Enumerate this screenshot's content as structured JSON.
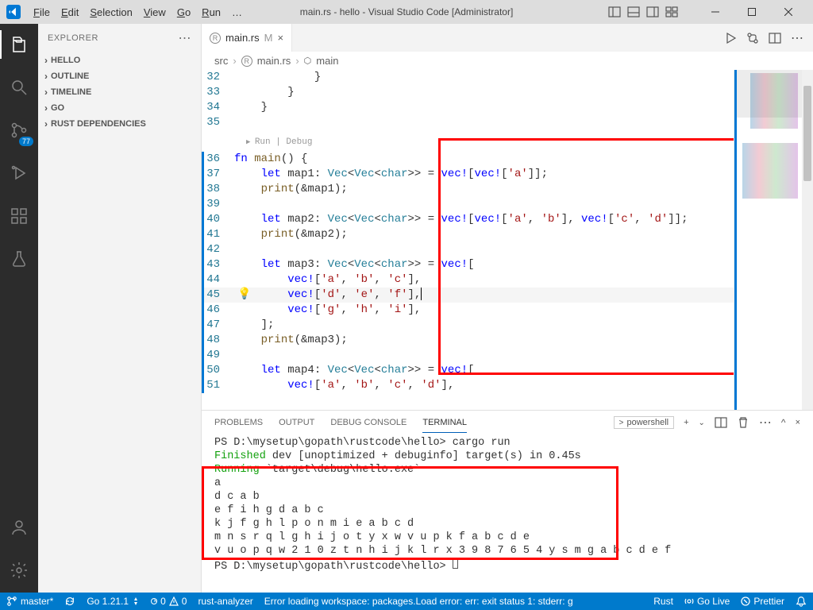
{
  "title": "main.rs - hello - Visual Studio Code [Administrator]",
  "menu": [
    "File",
    "Edit",
    "Selection",
    "View",
    "Go",
    "Run",
    "…"
  ],
  "explorer": {
    "title": "EXPLORER",
    "items": [
      "HELLO",
      "OUTLINE",
      "TIMELINE",
      "GO",
      "RUST DEPENDENCIES"
    ]
  },
  "activity_badge": "77",
  "tab": {
    "icon": "rust",
    "name": "main.rs",
    "modified": "M"
  },
  "breadcrumbs": [
    "src",
    "main.rs",
    "main"
  ],
  "codelens": "Run | Debug",
  "code_lines": [
    {
      "n": 32,
      "t": "            }"
    },
    {
      "n": 33,
      "t": "        }"
    },
    {
      "n": 34,
      "t": "    }"
    },
    {
      "n": 35,
      "t": ""
    },
    {
      "n": 36,
      "t": "fn main() {",
      "hl": false
    },
    {
      "n": 37,
      "t": "    let map1: Vec<Vec<char>> = vec![vec!['a']];"
    },
    {
      "n": 38,
      "t": "    print(&map1);"
    },
    {
      "n": 39,
      "t": ""
    },
    {
      "n": 40,
      "t": "    let map2: Vec<Vec<char>> = vec![vec!['a', 'b'], vec!['c', 'd']];"
    },
    {
      "n": 41,
      "t": "    print(&map2);"
    },
    {
      "n": 42,
      "t": ""
    },
    {
      "n": 43,
      "t": "    let map3: Vec<Vec<char>> = vec!["
    },
    {
      "n": 44,
      "t": "        vec!['a', 'b', 'c'],"
    },
    {
      "n": 45,
      "t": "        vec!['d', 'e', 'f'],",
      "hl": true,
      "bulb": true,
      "cursor": true
    },
    {
      "n": 46,
      "t": "        vec!['g', 'h', 'i'],"
    },
    {
      "n": 47,
      "t": "    ];"
    },
    {
      "n": 48,
      "t": "    print(&map3);"
    },
    {
      "n": 49,
      "t": ""
    },
    {
      "n": 50,
      "t": "    let map4: Vec<Vec<char>> = vec!["
    },
    {
      "n": 51,
      "t": "        vec!['a', 'b', 'c', 'd'],"
    }
  ],
  "panel": {
    "tabs": [
      "PROBLEMS",
      "OUTPUT",
      "DEBUG CONSOLE",
      "TERMINAL"
    ],
    "active": "TERMINAL",
    "shell": "powershell"
  },
  "terminal": {
    "prompt1": "PS D:\\mysetup\\gopath\\rustcode\\hello> ",
    "cmd": "cargo run",
    "finished_label": "Finished",
    "finished_rest": " dev [unoptimized + debuginfo] target(s) in 0.45s",
    "running_label": "Running",
    "running_rest": " `target\\debug\\hello.exe`",
    "out": [
      "a",
      "d c a b",
      "e f i h g d a b c",
      "k j f g h l p o n m i e a b c d",
      "m n s r q l g h i j o t y x w v u p k f a b c d e",
      "v u o p q w 2 1 0 z t n h i j k l r x 3 9 8 7 6 5 4 y s m g a b c d e f"
    ],
    "prompt2": "PS D:\\mysetup\\gopath\\rustcode\\hello> "
  },
  "status": {
    "branch": "master*",
    "go": "Go 1.21.1",
    "errors": "0",
    "warnings": "0",
    "rust_analyzer": "rust-analyzer",
    "err_msg": "Error loading workspace: packages.Load error: err: exit status 1: stderr: g",
    "lang": "Rust",
    "golive": "Go Live",
    "prettier": "Prettier"
  }
}
